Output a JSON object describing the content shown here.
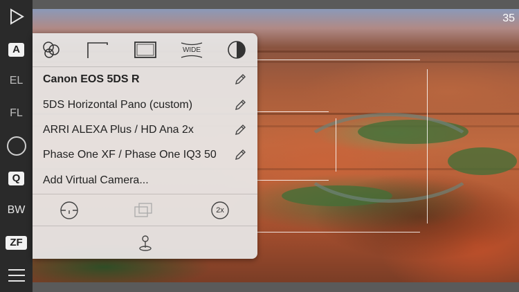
{
  "status": {
    "frame_count": "35"
  },
  "sidebar": {
    "items": [
      {
        "label": "A"
      },
      {
        "label": "EL"
      },
      {
        "label": "FL"
      },
      {
        "label": ""
      },
      {
        "label": "Q"
      },
      {
        "label": "BW"
      },
      {
        "label": "ZF"
      }
    ]
  },
  "panel": {
    "top_icons": [
      "lenses-icon",
      "frame-corner-icon",
      "frame-rect-icon",
      "wide-icon",
      "contrast-icon"
    ],
    "wide_label": "WIDE",
    "cameras": [
      {
        "label": "Canon EOS 5DS R",
        "selected": true
      },
      {
        "label": "5DS Horizontal Pano (custom)",
        "selected": false
      },
      {
        "label": "ARRI ALEXA Plus / HD Ana 2x",
        "selected": false
      },
      {
        "label": "Phase One XF / Phase One IQ3 50",
        "selected": false
      }
    ],
    "add_camera_label": "Add Virtual Camera...",
    "bottom_icons": [
      "level-icon",
      "overlay-frames-icon",
      "squeeze-2x-icon",
      "location-pin-icon"
    ],
    "squeeze_label": "2x"
  },
  "colors": {
    "panel_bg": "#e8e8e8",
    "sidebar_bg": "#2a2a2a",
    "bars": "#5a5a5a"
  }
}
